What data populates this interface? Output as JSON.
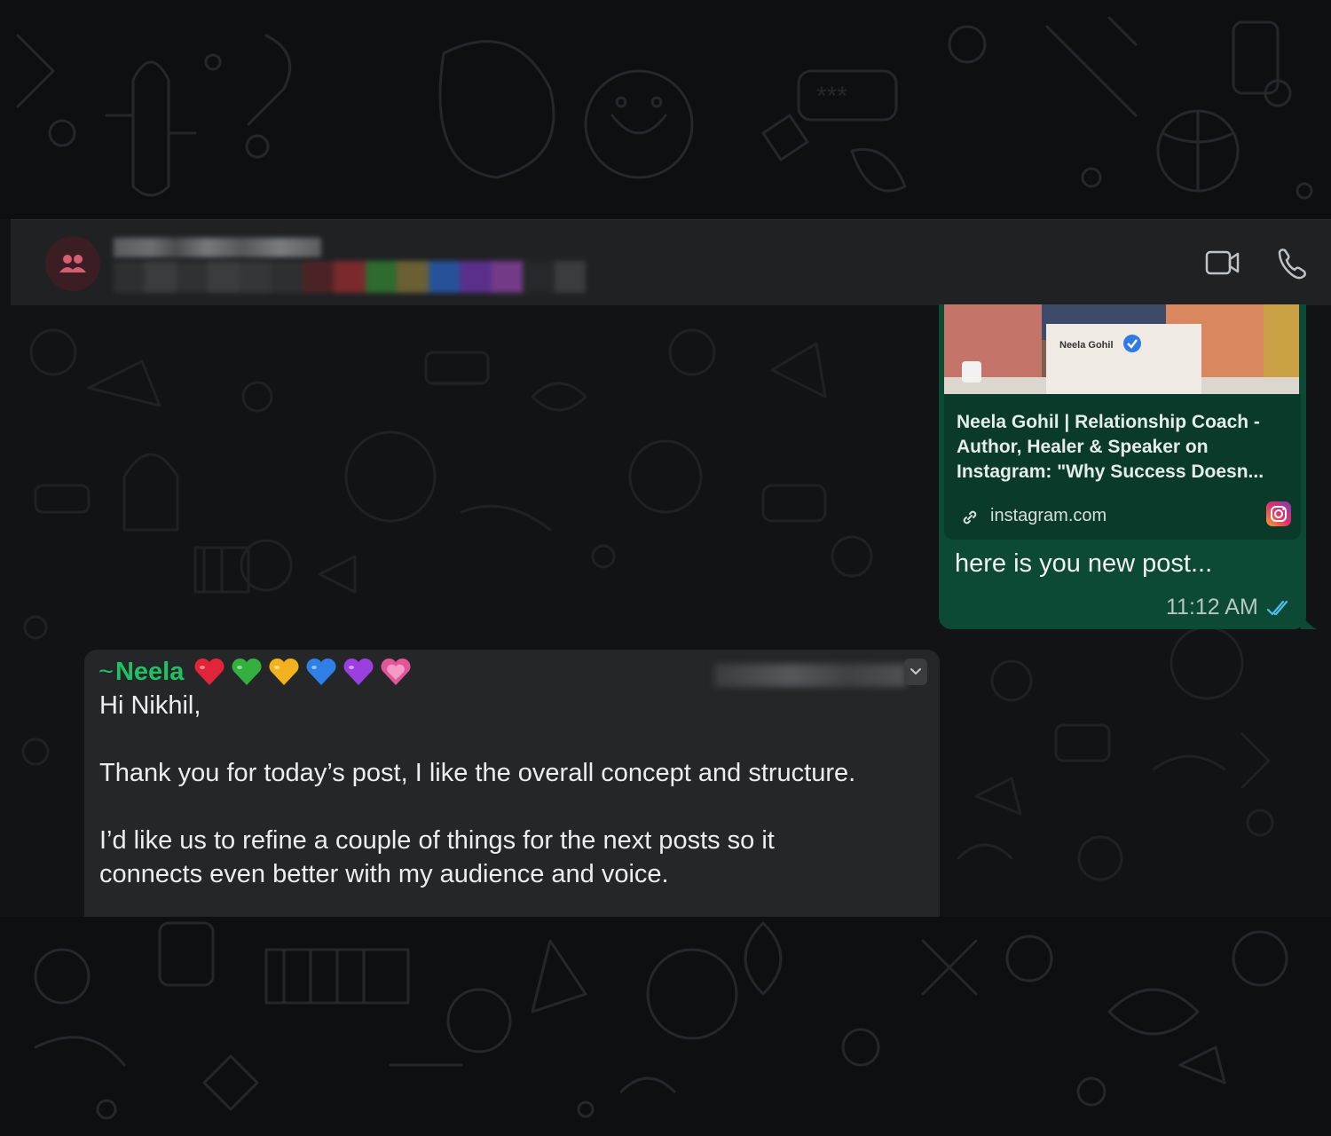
{
  "header": {
    "avatar_icon": "group-icon",
    "video_call_icon": "video-camera-icon",
    "voice_call_icon": "phone-icon"
  },
  "outgoing": {
    "link_preview": {
      "image_name": "Neela Gohil",
      "title_line1": "Neela Gohil | Relationship Coach -",
      "title_line2": "Author, Healer & Speaker on",
      "title_line3": "Instagram: \"Why Success Doesn...",
      "domain": "instagram.com"
    },
    "caption": "here is you new post...",
    "time": "11:12 AM",
    "status_icon": "double-check-icon",
    "bubble_color": "#0d4a35"
  },
  "incoming": {
    "sender_prefix": "~",
    "sender_name": "Neela",
    "heart_colors": [
      "#e0243a",
      "#35b040",
      "#f2b21f",
      "#2f7fe6",
      "#9b3fe0",
      "#e2559a"
    ],
    "greeting": "Hi Nikhil,",
    "paragraph1": "Thank you for today’s post, I like the overall concept and structure.",
    "paragraph2_line1": "I’d like us to refine a couple of things for the next posts so it",
    "paragraph2_line2": "connects even better with my audience and voice.",
    "sender_color": "#21c063"
  }
}
